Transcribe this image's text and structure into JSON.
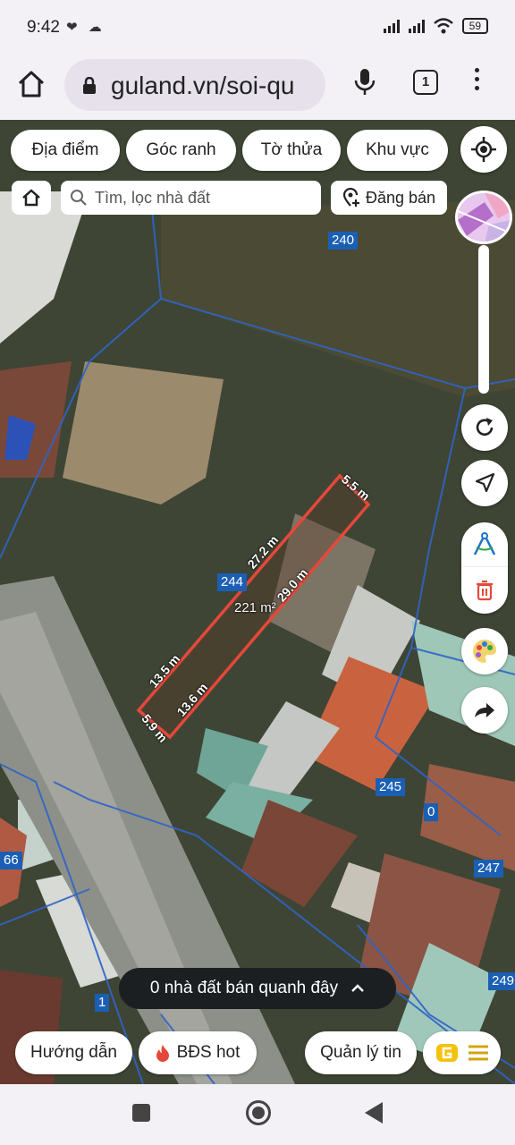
{
  "status_bar": {
    "time": "9:42",
    "left_icons": "❤ ☁",
    "battery": "59"
  },
  "browser": {
    "url": "guland.vn/soi-qu",
    "tab_count": "1"
  },
  "map": {
    "filter_chips": [
      "Địa điểm",
      "Góc ranh",
      "Tờ thửa",
      "Khu vực"
    ],
    "search_placeholder": "Tìm, lọc nhà đất",
    "post_label": "Đăng bán",
    "parcel_numbers": [
      "240",
      "244",
      "245",
      "0",
      "247",
      "249",
      "66",
      "1"
    ],
    "plot": {
      "area": "221 m²",
      "edges": [
        "5.5 m",
        "27.2 m",
        "29.0 m",
        "13.5 m",
        "13.6 m",
        "5.9 m"
      ]
    },
    "nearby_text": "0 nhà đất bán quanh đây",
    "bottom_buttons": {
      "guide": "Hướng dẫn",
      "hot": "BĐS hot",
      "manage": "Quản lý tin"
    },
    "colors": {
      "plot_outline": "#e5483a",
      "parcel_label_bg": "#1a5fb4",
      "accent": "#f4c20d"
    }
  }
}
